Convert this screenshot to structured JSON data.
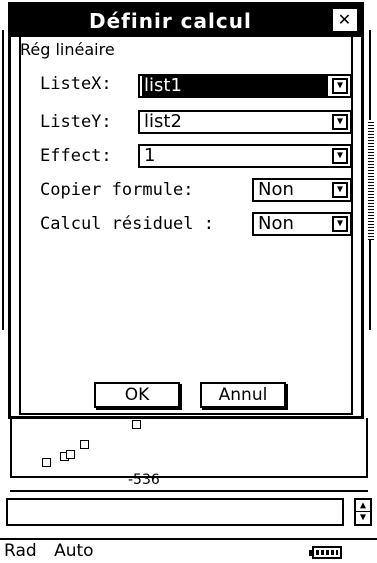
{
  "dialog": {
    "title": "Définir calcul",
    "close": "✕",
    "subtitle": "Rég linéaire",
    "fields": {
      "listx_label": "ListeX:",
      "listx_value": "list1",
      "listy_label": "ListeY:",
      "listy_value": "list2",
      "effect_label": "Effect:",
      "effect_value": "1",
      "copy_label": "Copier formule:",
      "copy_value": "Non",
      "residual_label": "Calcul résiduel :",
      "residual_value": "Non"
    },
    "ok_label": "OK",
    "cancel_label": "Annul"
  },
  "background": {
    "axis_value": "-536"
  },
  "statusbar": {
    "angle": "Rad",
    "mode": "Auto"
  }
}
